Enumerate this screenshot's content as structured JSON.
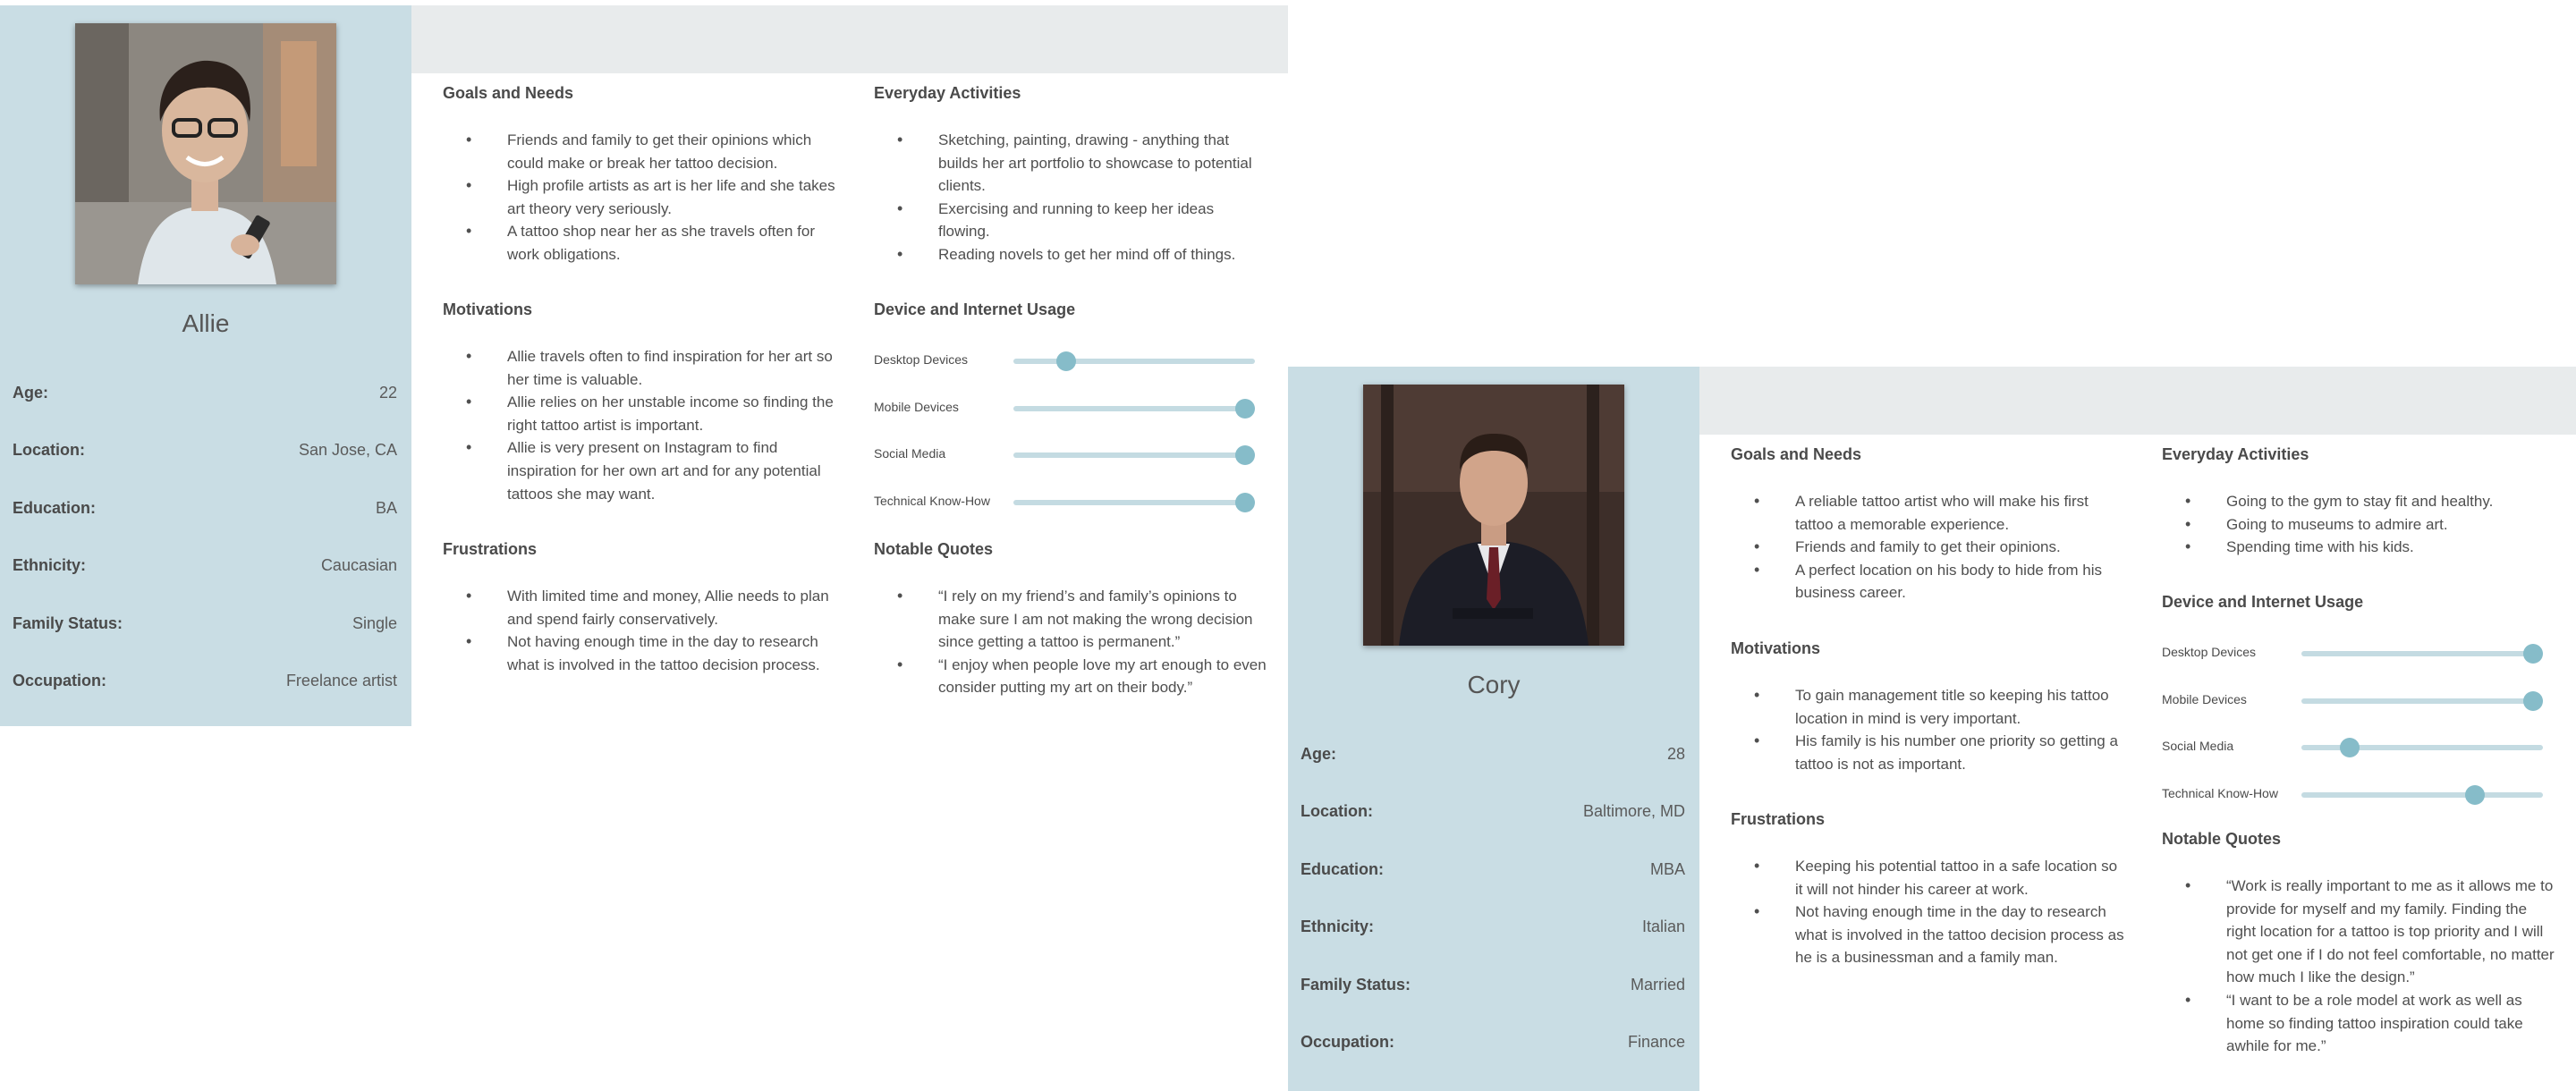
{
  "personas": [
    {
      "name": "Allie",
      "facts": [
        {
          "label": "Age:",
          "value": "22"
        },
        {
          "label": "Location:",
          "value": "San Jose, CA"
        },
        {
          "label": "Education:",
          "value": "BA"
        },
        {
          "label": "Ethnicity:",
          "value": "Caucasian"
        },
        {
          "label": "Family Status:",
          "value": "Single"
        },
        {
          "label": "Occupation:",
          "value": "Freelance artist"
        }
      ],
      "goals": {
        "title": "Goals and Needs",
        "items": [
          "Friends and family to get their opinions which could make or break her tattoo decision.",
          "High profile artists as art is her life and she takes art theory very seriously.",
          "A tattoo shop near her as she travels often for work obligations."
        ]
      },
      "motivations": {
        "title": "Motivations",
        "items": [
          "Allie travels often to find inspiration for her art so her time is valuable.",
          "Allie relies on her unstable income so finding the right tattoo artist is important.",
          "Allie is very present on Instagram to find inspiration for her own art and for any potential tattoos she may want."
        ]
      },
      "frustrations": {
        "title": "Frustrations",
        "items": [
          "With limited time and money, Allie needs to plan and spend fairly conservatively.",
          "Not having enough time in the day to research what is involved in the tattoo decision process."
        ]
      },
      "activities": {
        "title": "Everyday Activities",
        "items": [
          "Sketching, painting, drawing - anything that builds her art portfolio to showcase to potential clients.",
          "Exercising and running to keep her ideas flowing.",
          "Reading novels to get her mind off of things."
        ]
      },
      "device": {
        "title": "Device and Internet Usage",
        "sliders": [
          {
            "label": "Desktop Devices",
            "level": 0.22
          },
          {
            "label": "Mobile Devices",
            "level": 0.96
          },
          {
            "label": "Social Media",
            "level": 0.96
          },
          {
            "label": "Technical Know-How",
            "level": 0.96
          }
        ]
      },
      "quotes": {
        "title": "Notable Quotes",
        "items": [
          "“I rely on my friend’s and family’s opinions to make sure I am not making the wrong decision since getting a tattoo is permanent.”",
          "“I enjoy when people love my art enough to even consider putting my art on their body.”"
        ]
      }
    },
    {
      "name": "Cory",
      "facts": [
        {
          "label": "Age:",
          "value": "28"
        },
        {
          "label": "Location:",
          "value": "Baltimore, MD"
        },
        {
          "label": "Education:",
          "value": "MBA"
        },
        {
          "label": "Ethnicity:",
          "value": "Italian"
        },
        {
          "label": "Family Status:",
          "value": "Married"
        },
        {
          "label": "Occupation:",
          "value": "Finance"
        }
      ],
      "goals": {
        "title": "Goals and Needs",
        "items": [
          "A reliable tattoo artist who will make his first tattoo a memorable experience.",
          "Friends and family to get their opinions.",
          "A perfect location on his body to hide from his business career."
        ]
      },
      "motivations": {
        "title": "Motivations",
        "items": [
          "To gain management title so keeping his tattoo location in mind is very important.",
          "His family is his number one priority so getting a tattoo is not as important."
        ]
      },
      "frustrations": {
        "title": "Frustrations",
        "items": [
          "Keeping his potential tattoo in a safe location so it will not hinder his career at work.",
          "Not having enough time in the day to research what is involved in the tattoo decision process as he is a businessman and a family man."
        ]
      },
      "activities": {
        "title": "Everyday Activities",
        "items": [
          "Going to the gym to stay fit and healthy.",
          "Going to museums to admire art.",
          "Spending time with his kids."
        ]
      },
      "device": {
        "title": "Device and Internet Usage",
        "sliders": [
          {
            "label": "Desktop Devices",
            "level": 0.96
          },
          {
            "label": "Mobile Devices",
            "level": 0.96
          },
          {
            "label": "Social Media",
            "level": 0.2
          },
          {
            "label": "Technical Know-How",
            "level": 0.72
          }
        ]
      },
      "quotes": {
        "title": "Notable Quotes",
        "items": [
          "“Work is really important to me as it allows me to provide for myself and my family. Finding the right location for a tattoo is top priority and I will not get one if I do not feel comfortable, no matter how much I like the design.”",
          "“I want to be a role model at work as well as home so finding tattoo inspiration could take awhile for me.”"
        ]
      }
    }
  ],
  "colors": {
    "sidebar": "#c9dde4",
    "topbar": "#e8ebec",
    "slider_track": "#c4dbe2",
    "slider_knob": "#86bcc9"
  }
}
